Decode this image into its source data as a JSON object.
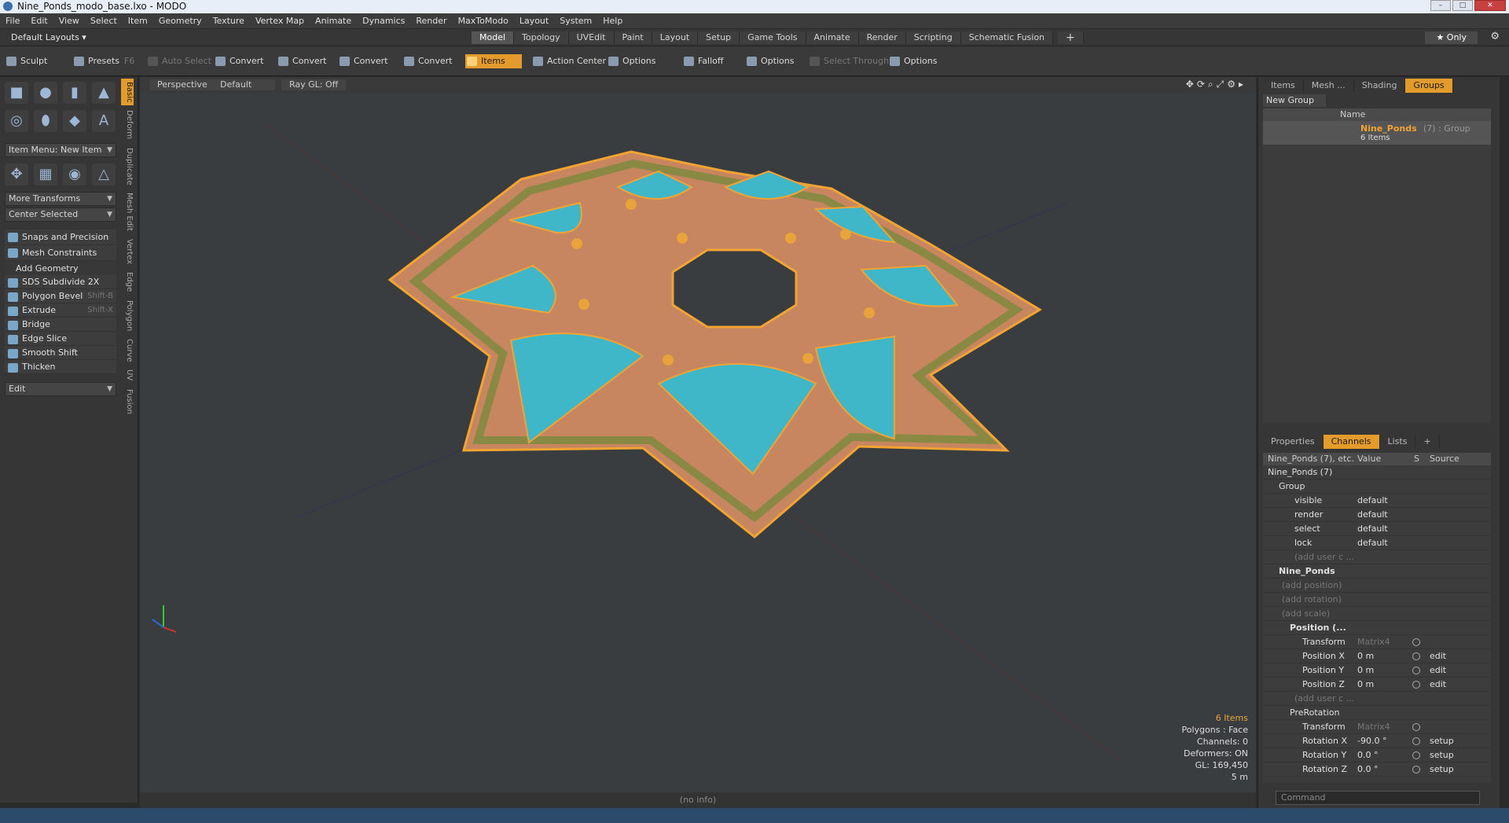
{
  "window": {
    "title": "Nine_Ponds_modo_base.lxo - MODO",
    "controls": [
      "–",
      "□",
      "✕"
    ]
  },
  "menu": [
    "File",
    "Edit",
    "View",
    "Select",
    "Item",
    "Geometry",
    "Texture",
    "Vertex Map",
    "Animate",
    "Dynamics",
    "Render",
    "MaxToModo",
    "Layout",
    "System",
    "Help"
  ],
  "layouts": {
    "default_label": "Default Layouts ▾",
    "tabs": [
      "Model",
      "Topology",
      "UVEdit",
      "Paint",
      "Layout",
      "Setup",
      "Game Tools",
      "Animate",
      "Render",
      "Scripting",
      "Schematic Fusion"
    ],
    "active": "Model",
    "only": "★ Only"
  },
  "toolbar": {
    "sculpt": "Sculpt",
    "presets": "Presets",
    "presets_key": "F6",
    "auto_select": "Auto Select",
    "convert1": "Convert",
    "convert2": "Convert",
    "convert3": "Convert",
    "convert4": "Convert",
    "items": "Items",
    "action_center": "Action Center",
    "options1": "Options",
    "falloff": "Falloff",
    "options2": "Options",
    "select_through": "Select Through",
    "options3": "Options"
  },
  "left": {
    "item_menu": "Item Menu: New Item",
    "more_transforms": "More Transforms",
    "center_selected": "Center Selected",
    "snaps": "Snaps and Precision",
    "mesh_constraints": "Mesh Constraints",
    "add_geometry": "Add Geometry",
    "tools": [
      {
        "label": "SDS Subdivide 2X",
        "key": ""
      },
      {
        "label": "Polygon Bevel",
        "key": "Shift-B"
      },
      {
        "label": "Extrude",
        "key": "Shift-X"
      },
      {
        "label": "Bridge",
        "key": ""
      },
      {
        "label": "Edge Slice",
        "key": ""
      },
      {
        "label": "Smooth Shift",
        "key": ""
      },
      {
        "label": "Thicken",
        "key": ""
      }
    ],
    "edit": "Edit",
    "vtabs": [
      "Basic",
      "Deform",
      "Duplicate",
      "Mesh Edit",
      "Vertex",
      "Edge",
      "Polygon",
      "Curve",
      "UV",
      "Fusion"
    ]
  },
  "viewport": {
    "view": "Perspective",
    "shading": "Default",
    "raygl": "Ray GL: Off",
    "stats": [
      "6 Items",
      "Polygons : Face",
      "Channels: 0",
      "Deformers: ON",
      "GL: 169,450",
      "5 m"
    ],
    "status": "(no info)"
  },
  "right": {
    "tabs": [
      "Items",
      "Mesh ...",
      "Shading",
      "Groups"
    ],
    "active_tab": "Groups",
    "new_group": "New Group",
    "name_col": "Name",
    "group_name": "Nine_Ponds",
    "group_suffix": "(7) : Group",
    "group_count": "6 Items",
    "lower_tabs": [
      "Properties",
      "Channels",
      "Lists",
      "+"
    ],
    "lower_active": "Channels",
    "ch_head": {
      "name": "Nine_Ponds (7), etc.",
      "value": "Value",
      "s": "S",
      "source": "Source"
    },
    "channels": [
      {
        "n": "Nine_Ponds (7)",
        "v": "",
        "src": "",
        "indent": 6,
        "bold": false
      },
      {
        "n": "Group",
        "v": "",
        "src": "",
        "indent": 20,
        "bold": false
      },
      {
        "n": "visible",
        "v": "default",
        "src": "",
        "indent": 40,
        "bold": false
      },
      {
        "n": "render",
        "v": "default",
        "src": "",
        "indent": 40,
        "bold": false
      },
      {
        "n": "select",
        "v": "default",
        "src": "",
        "indent": 40,
        "bold": false
      },
      {
        "n": "lock",
        "v": "default",
        "src": "",
        "indent": 40,
        "bold": false
      },
      {
        "n": "(add user c ...",
        "v": "",
        "src": "",
        "indent": 40,
        "bold": false
      },
      {
        "n": "Nine_Ponds",
        "v": "",
        "src": "",
        "indent": 20,
        "bold": true
      },
      {
        "n": "(add position)",
        "v": "",
        "src": "",
        "indent": 24,
        "bold": false
      },
      {
        "n": "(add rotation)",
        "v": "",
        "src": "",
        "indent": 24,
        "bold": false
      },
      {
        "n": "(add scale)",
        "v": "",
        "src": "",
        "indent": 24,
        "bold": false
      },
      {
        "n": "Position (...",
        "v": "",
        "src": "",
        "indent": 34,
        "bold": true
      },
      {
        "n": "Transform",
        "v": "Matrix4",
        "src": "",
        "indent": 50,
        "bold": false
      },
      {
        "n": "Position X",
        "v": "0 m",
        "src": "edit",
        "indent": 50,
        "bold": false
      },
      {
        "n": "Position Y",
        "v": "0 m",
        "src": "edit",
        "indent": 50,
        "bold": false
      },
      {
        "n": "Position Z",
        "v": "0 m",
        "src": "edit",
        "indent": 50,
        "bold": false
      },
      {
        "n": "(add user c ...",
        "v": "",
        "src": "",
        "indent": 40,
        "bold": false
      },
      {
        "n": "PreRotation",
        "v": "",
        "src": "",
        "indent": 34,
        "bold": false
      },
      {
        "n": "Transform",
        "v": "Matrix4",
        "src": "",
        "indent": 50,
        "bold": false
      },
      {
        "n": "Rotation X",
        "v": "-90.0 °",
        "src": "setup",
        "indent": 50,
        "bold": false
      },
      {
        "n": "Rotation Y",
        "v": "0.0 °",
        "src": "setup",
        "indent": 50,
        "bold": false
      },
      {
        "n": "Rotation Z",
        "v": "0.0 °",
        "src": "setup",
        "indent": 50,
        "bold": false
      }
    ],
    "command_placeholder": "Command"
  },
  "colors": {
    "accent": "#e39b2c",
    "water": "#3fb7c8",
    "stone": "#c7865f",
    "grass": "#7a8a3c",
    "wire": "#f2a433"
  }
}
